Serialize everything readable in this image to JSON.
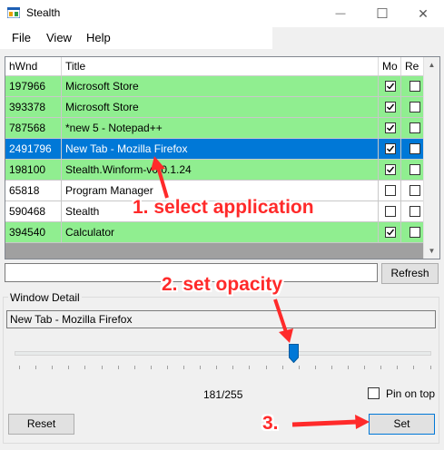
{
  "window": {
    "title": "Stealth",
    "minimize_glyph": "—",
    "maximize_glyph": "☐",
    "close_glyph": "✕"
  },
  "menu": [
    "File",
    "View",
    "Help"
  ],
  "grid": {
    "columns": [
      "hWnd",
      "Title",
      "Mo",
      "Re"
    ],
    "rows": [
      {
        "hwnd": "197966",
        "title": "Microsoft Store",
        "mo": true,
        "re": false,
        "style": "green"
      },
      {
        "hwnd": "393378",
        "title": "Microsoft Store",
        "mo": true,
        "re": false,
        "style": "green"
      },
      {
        "hwnd": "787568",
        "title": "*new 5 - Notepad++",
        "mo": true,
        "re": false,
        "style": "green"
      },
      {
        "hwnd": "2491796",
        "title": "New Tab - Mozilla Firefox",
        "mo": true,
        "re": false,
        "style": "selected"
      },
      {
        "hwnd": "198100",
        "title": "Stealth.Winform-v0.0.1.24",
        "mo": true,
        "re": false,
        "style": "green"
      },
      {
        "hwnd": "65818",
        "title": "Program Manager",
        "mo": false,
        "re": false,
        "style": "white"
      },
      {
        "hwnd": "590468",
        "title": "Stealth",
        "mo": false,
        "re": false,
        "style": "white"
      },
      {
        "hwnd": "394540",
        "title": "Calculator",
        "mo": true,
        "re": false,
        "style": "green"
      }
    ],
    "colors": {
      "green": "#90ee90",
      "white": "#ffffff",
      "selected": "#0078d7"
    }
  },
  "filter": {
    "value": ""
  },
  "buttons": {
    "refresh": "Refresh",
    "reset": "Reset",
    "set": "Set"
  },
  "detail": {
    "group_title": "Window Detail",
    "window_title": "New Tab - Mozilla Firefox",
    "opacity_value": 181,
    "opacity_max": 255,
    "opacity_text": "181/255",
    "pin_on_top_label": "Pin on top",
    "pin_on_top_checked": false
  },
  "annotations": {
    "step1": "1. select application",
    "step2": "2. set opacity",
    "step3": "3.",
    "color": "#ff2a2a"
  },
  "icons": [
    "stealth-app-icon",
    "minimize-icon",
    "maximize-icon",
    "close-icon",
    "checkmark-icon",
    "scroll-up-arrow-icon",
    "scroll-down-arrow-icon",
    "slider-thumb-icon",
    "red-arrow-icon"
  ]
}
